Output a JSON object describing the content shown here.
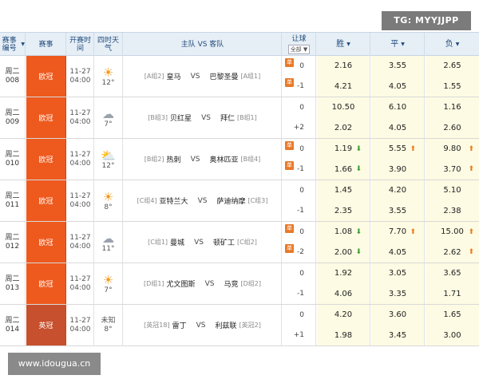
{
  "watermark_top": "TG: MYYJJPP",
  "watermark_bottom": "www.idougua.cn",
  "header": {
    "col_no": "赛事编号",
    "col_league": "赛事",
    "col_time": "开赛时间",
    "col_weather": "四时天气",
    "col_teams": "主队 VS 客队",
    "col_handicap": "让球",
    "col_handicap_filter": "全部",
    "col_win": "胜",
    "col_draw": "平",
    "col_lose": "负"
  },
  "matches": [
    {
      "day": "周二",
      "num": "008",
      "league": "欧冠",
      "date": "11-27",
      "time": "04:00",
      "weather_icon": "sun-icon",
      "weather": "12°",
      "home_grp": "[A组2]",
      "home": "皇马",
      "away": "巴黎圣曼",
      "away_grp": "[A组1]",
      "h1": "0",
      "h2": "-1",
      "badge": "单",
      "w1": "2.16",
      "d1": "3.55",
      "l1": "2.65",
      "w2": "4.21",
      "d2": "4.05",
      "l2": "1.55"
    },
    {
      "day": "周二",
      "num": "009",
      "league": "欧冠",
      "date": "11-27",
      "time": "04:00",
      "weather_icon": "cloud-rain-icon",
      "weather": "7°",
      "home_grp": "[B组3]",
      "home": "贝红星",
      "away": "拜仁",
      "away_grp": "[B组1]",
      "h1": "0",
      "h2": "+2",
      "badge": "",
      "w1": "10.50",
      "d1": "6.10",
      "l1": "1.16",
      "w2": "2.02",
      "d2": "4.05",
      "l2": "2.60"
    },
    {
      "day": "周二",
      "num": "010",
      "league": "欧冠",
      "date": "11-27",
      "time": "04:00",
      "weather_icon": "sun-cloud-icon",
      "weather": "12°",
      "home_grp": "[B组2]",
      "home": "热刺",
      "away": "奥林匹亚",
      "away_grp": "[B组4]",
      "h1": "0",
      "h2": "-1",
      "badge": "单",
      "w1": "1.19",
      "d1": "5.55",
      "l1": "9.80",
      "w2": "1.66",
      "d2": "3.90",
      "l2": "3.70"
    },
    {
      "day": "周二",
      "num": "011",
      "league": "欧冠",
      "date": "11-27",
      "time": "04:00",
      "weather_icon": "sun-icon",
      "weather": "8°",
      "home_grp": "[C组4]",
      "home": "亚特兰大",
      "away": "萨迪纳摩",
      "away_grp": "[C组3]",
      "h1": "0",
      "h2": "-1",
      "badge": "",
      "w1": "1.45",
      "d1": "4.20",
      "l1": "5.10",
      "w2": "2.35",
      "d2": "3.55",
      "l2": "2.38"
    },
    {
      "day": "周二",
      "num": "012",
      "league": "欧冠",
      "date": "11-27",
      "time": "04:00",
      "weather_icon": "cloud-rain-icon",
      "weather": "11°",
      "home_grp": "[C组1]",
      "home": "曼城",
      "away": "顿矿工",
      "away_grp": "[C组2]",
      "h1": "0",
      "h2": "-2",
      "badge": "单",
      "w1": "1.08",
      "d1": "7.70",
      "l1": "15.00",
      "w2": "2.00",
      "d2": "4.05",
      "l2": "2.62"
    },
    {
      "day": "周二",
      "num": "013",
      "league": "欧冠",
      "date": "11-27",
      "time": "04:00",
      "weather_icon": "sun-icon",
      "weather": "7°",
      "home_grp": "[D组1]",
      "home": "尤文图斯",
      "away": "马竞",
      "away_grp": "[D组2]",
      "h1": "0",
      "h2": "-1",
      "badge": "",
      "w1": "1.92",
      "d1": "3.05",
      "l1": "3.65",
      "w2": "4.06",
      "d2": "3.35",
      "l2": "1.71"
    },
    {
      "day": "周二",
      "num": "014",
      "league": "英冠",
      "date": "11-27",
      "time": "04:00",
      "weather_icon": "unknown",
      "weather_unknown": "未知",
      "weather": "8°",
      "home_grp": "[英冠18]",
      "home": "雷丁",
      "away": "利兹联",
      "away_grp": "[英冠2]",
      "h1": "0",
      "h2": "+1",
      "badge": "",
      "w1": "4.20",
      "d1": "3.60",
      "l1": "1.65",
      "w2": "1.98",
      "d2": "3.45",
      "l2": "3.00"
    }
  ],
  "colors": {
    "league_ucl": "#ee5a1e",
    "league_champ": "#c7502e",
    "odds_bg": "#fdfbe3",
    "header_bg": "#e6eef6",
    "arrow_down": "#3c9b32",
    "arrow_up": "#ee7a1a"
  }
}
